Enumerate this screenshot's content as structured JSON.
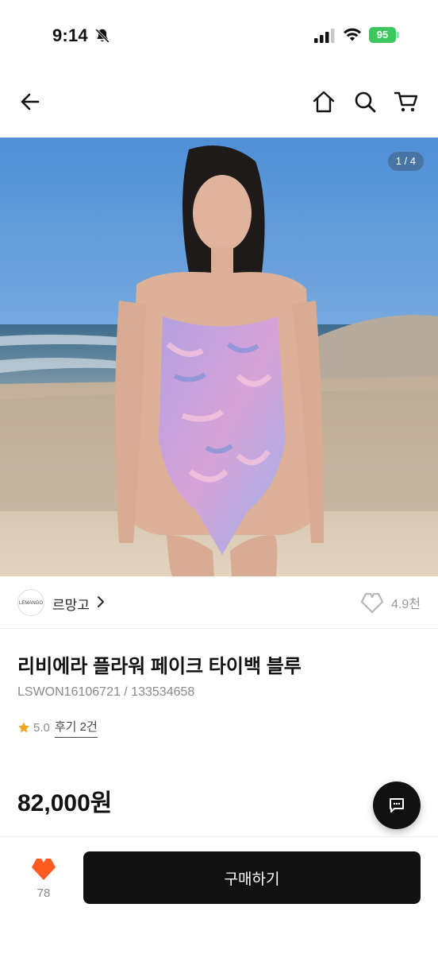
{
  "status_bar": {
    "time": "9:14",
    "battery": "95"
  },
  "nav": {
    "icons": [
      "back-arrow-icon",
      "home-icon",
      "search-icon",
      "cart-icon"
    ]
  },
  "gallery": {
    "counter": "1 / 4"
  },
  "brand": {
    "logo_text": "LEMANGO",
    "name": "르망고",
    "like_count": "4.9천"
  },
  "product": {
    "title": "리비에라 플라워 페이크 타이백 블루",
    "code": "LSWON16106721 / 133534658",
    "rating": "5.0",
    "review_label": "후기 2건",
    "price": "82,000원"
  },
  "bottom_bar": {
    "wish_count": "78",
    "buy_label": "구매하기"
  },
  "colors": {
    "accent": "#ff5a1f",
    "star": "#f5a623",
    "buy_button": "#111111",
    "battery": "#3dc75f"
  }
}
